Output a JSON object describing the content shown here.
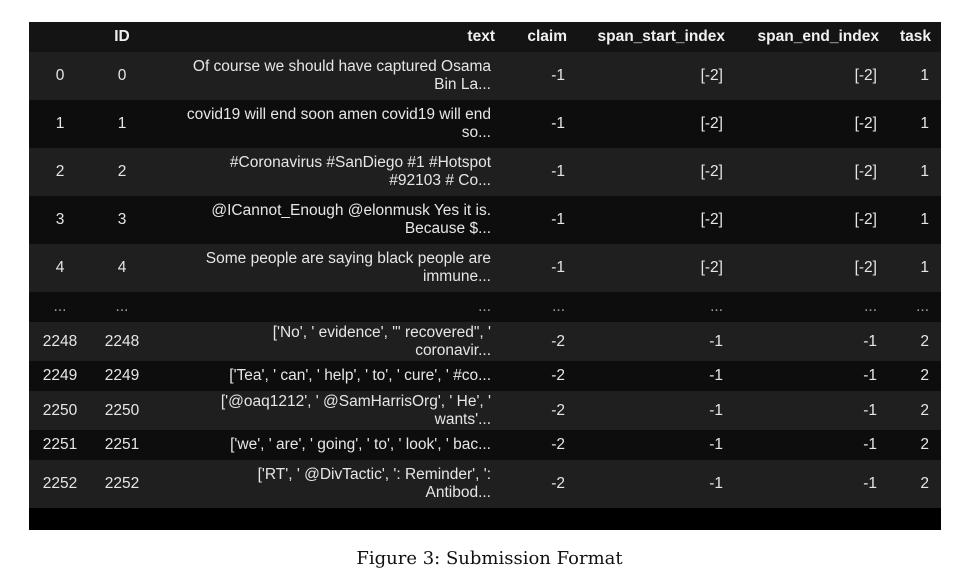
{
  "table": {
    "columns": [
      "",
      "ID",
      "text",
      "claim",
      "span_start_index",
      "span_end_index",
      "task"
    ],
    "rows": [
      {
        "idx": "0",
        "id": "0",
        "text": [
          "Of course we should have captured Osama",
          "Bin La..."
        ],
        "claim": "-1",
        "span_start_index": "[-2]",
        "span_end_index": "[-2]",
        "task": "1"
      },
      {
        "idx": "1",
        "id": "1",
        "text": [
          "covid19 will end soon amen covid19 will end",
          "so..."
        ],
        "claim": "-1",
        "span_start_index": "[-2]",
        "span_end_index": "[-2]",
        "task": "1"
      },
      {
        "idx": "2",
        "id": "2",
        "text": [
          "#Coronavirus #SanDiego #1 #Hotspot",
          "#92103 # Co..."
        ],
        "claim": "-1",
        "span_start_index": "[-2]",
        "span_end_index": "[-2]",
        "task": "1"
      },
      {
        "idx": "3",
        "id": "3",
        "text": [
          "@ICannot_Enough @elonmusk Yes it is.",
          "Because $..."
        ],
        "claim": "-1",
        "span_start_index": "[-2]",
        "span_end_index": "[-2]",
        "task": "1"
      },
      {
        "idx": "4",
        "id": "4",
        "text": [
          "Some people are saying black people are",
          "immune..."
        ],
        "claim": "-1",
        "span_start_index": "[-2]",
        "span_end_index": "[-2]",
        "task": "1"
      },
      {
        "idx": "...",
        "id": "...",
        "text": [
          "..."
        ],
        "claim": "...",
        "span_start_index": "...",
        "span_end_index": "...",
        "task": "..."
      },
      {
        "idx": "2248",
        "id": "2248",
        "text": [
          "['No', ' evidence', \"' recovered\", '",
          "coronavir..."
        ],
        "claim": "-2",
        "span_start_index": "-1",
        "span_end_index": "-1",
        "task": "2"
      },
      {
        "idx": "2249",
        "id": "2249",
        "text": [
          "['Tea', ' can', ' help', ' to', ' cure', ' #co..."
        ],
        "claim": "-2",
        "span_start_index": "-1",
        "span_end_index": "-1",
        "task": "2"
      },
      {
        "idx": "2250",
        "id": "2250",
        "text": [
          "['@oaq1212', ' @SamHarrisOrg', ' He', '",
          "wants'..."
        ],
        "claim": "-2",
        "span_start_index": "-1",
        "span_end_index": "-1",
        "task": "2"
      },
      {
        "idx": "2251",
        "id": "2251",
        "text": [
          "['we', ' are', ' going', ' to', ' look', ' bac..."
        ],
        "claim": "-2",
        "span_start_index": "-1",
        "span_end_index": "-1",
        "task": "2"
      },
      {
        "idx": "2252",
        "id": "2252",
        "text": [
          "['RT', ' @DivTactic', ': Reminder', ':",
          "Antibod..."
        ],
        "claim": "-2",
        "span_start_index": "-1",
        "span_end_index": "-1",
        "task": "2"
      }
    ]
  },
  "caption": "Figure 3: Submission Format"
}
